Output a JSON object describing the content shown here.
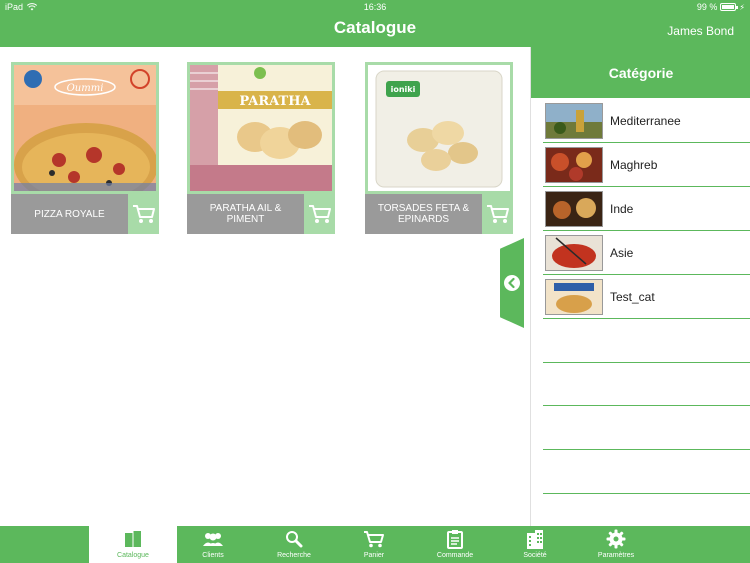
{
  "status": {
    "device": "iPad",
    "time": "16:36",
    "battery": "99 %",
    "battery_level": 0.99
  },
  "header": {
    "title": "Catalogue",
    "user": "James Bond"
  },
  "products": [
    {
      "name": "PIZZA ROYALE"
    },
    {
      "name": "PARATHA AIL & PIMENT"
    },
    {
      "name": "TORSADES FETA & EPINARDS"
    }
  ],
  "panel": {
    "title": "Catégorie",
    "categories": [
      {
        "label": "Mediterranee"
      },
      {
        "label": "Maghreb"
      },
      {
        "label": "Inde"
      },
      {
        "label": "Asie"
      },
      {
        "label": "Test_cat"
      }
    ]
  },
  "tabs": [
    {
      "label": "Catalogue",
      "icon": "book-icon",
      "active": true
    },
    {
      "label": "Clients",
      "icon": "users-icon"
    },
    {
      "label": "Recherche",
      "icon": "search-icon"
    },
    {
      "label": "Panier",
      "icon": "cart-icon"
    },
    {
      "label": "Commande",
      "icon": "clipboard-icon"
    },
    {
      "label": "Société",
      "icon": "building-icon"
    },
    {
      "label": "Paramètres",
      "icon": "gear-icon"
    }
  ],
  "colors": {
    "brand": "#5cb85c",
    "accent_light": "#a8dba8",
    "label_bar": "#9a9a9a"
  }
}
